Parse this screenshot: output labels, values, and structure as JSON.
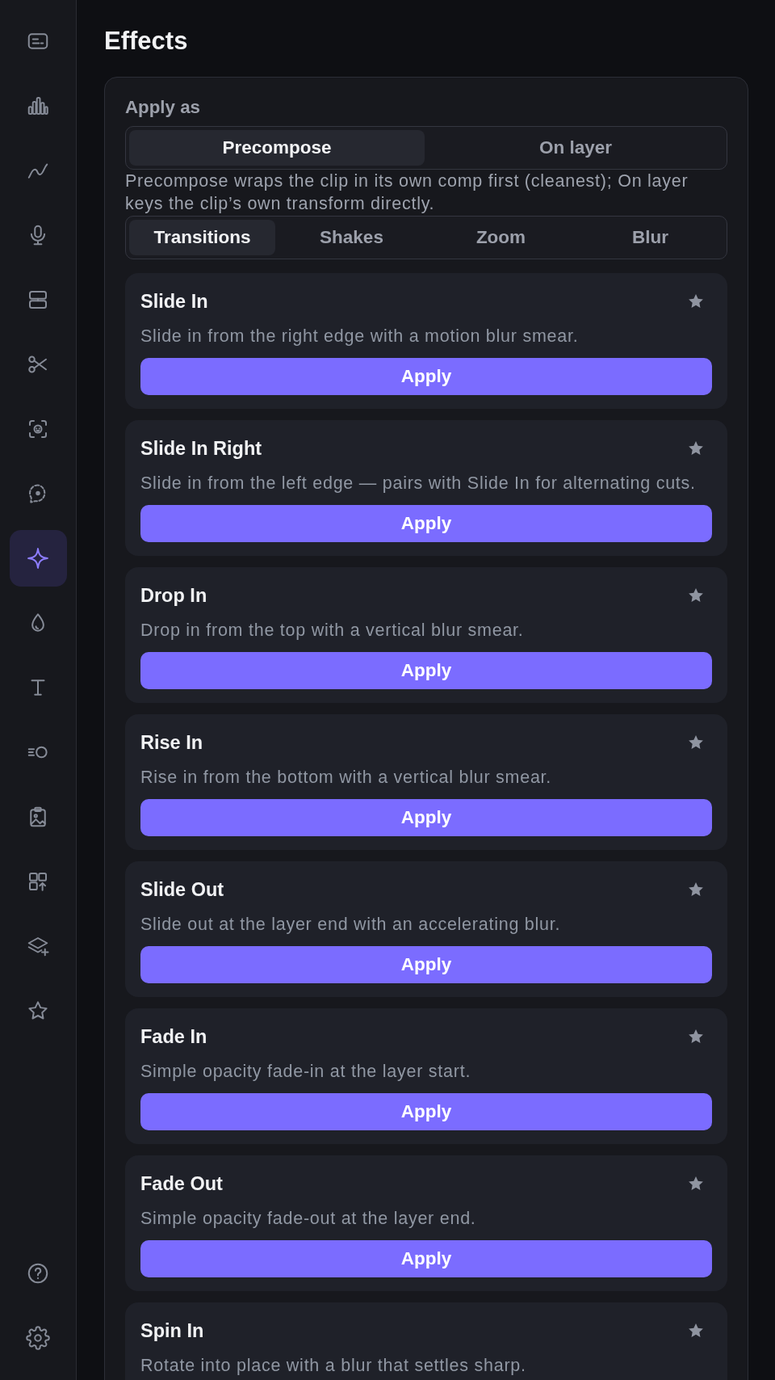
{
  "sidebar": {
    "items": [
      {
        "kind": "captions",
        "selected": false
      },
      {
        "kind": "bars",
        "selected": false
      },
      {
        "kind": "curve",
        "selected": false
      },
      {
        "kind": "microphone",
        "selected": false
      },
      {
        "kind": "layout",
        "selected": false
      },
      {
        "kind": "scissors",
        "selected": false
      },
      {
        "kind": "face-scan",
        "selected": false
      },
      {
        "kind": "chat",
        "selected": false
      },
      {
        "kind": "sparkle",
        "selected": true
      },
      {
        "kind": "drop",
        "selected": false
      },
      {
        "kind": "text",
        "selected": false
      },
      {
        "kind": "motion",
        "selected": false
      },
      {
        "kind": "clipboard-image",
        "selected": false
      },
      {
        "kind": "grid-upload",
        "selected": false
      },
      {
        "kind": "layers-plus",
        "selected": false
      },
      {
        "kind": "star",
        "selected": false
      }
    ],
    "footer_items": [
      {
        "kind": "help"
      },
      {
        "kind": "settings"
      }
    ]
  },
  "title": "Effects",
  "apply_as": {
    "label": "Apply as",
    "options": [
      {
        "label": "Precompose",
        "selected": true
      },
      {
        "label": "On layer",
        "selected": false
      }
    ],
    "hint": "Precompose wraps the clip in its own comp first (cleanest); On layer keys the clip’s own transform directly."
  },
  "categories": [
    {
      "label": "Transitions",
      "selected": true
    },
    {
      "label": "Shakes",
      "selected": false
    },
    {
      "label": "Zoom",
      "selected": false
    },
    {
      "label": "Blur",
      "selected": false
    }
  ],
  "effects": [
    {
      "title": "Slide In",
      "description": "Slide in from the right edge with a motion blur smear.",
      "button": "Apply"
    },
    {
      "title": "Slide In Right",
      "description": "Slide in from the left edge — pairs with Slide In for alternating cuts.",
      "button": "Apply"
    },
    {
      "title": "Drop In",
      "description": "Drop in from the top with a vertical blur smear.",
      "button": "Apply"
    },
    {
      "title": "Rise In",
      "description": "Rise in from the bottom with a vertical blur smear.",
      "button": "Apply"
    },
    {
      "title": "Slide Out",
      "description": "Slide out at the layer end with an accelerating blur.",
      "button": "Apply"
    },
    {
      "title": "Fade In",
      "description": "Simple opacity fade-in at the layer start.",
      "button": "Apply"
    },
    {
      "title": "Fade Out",
      "description": "Simple opacity fade-out at the layer end.",
      "button": "Apply"
    },
    {
      "title": "Spin In",
      "description": "Rotate into place with a blur that settles sharp."
    }
  ]
}
